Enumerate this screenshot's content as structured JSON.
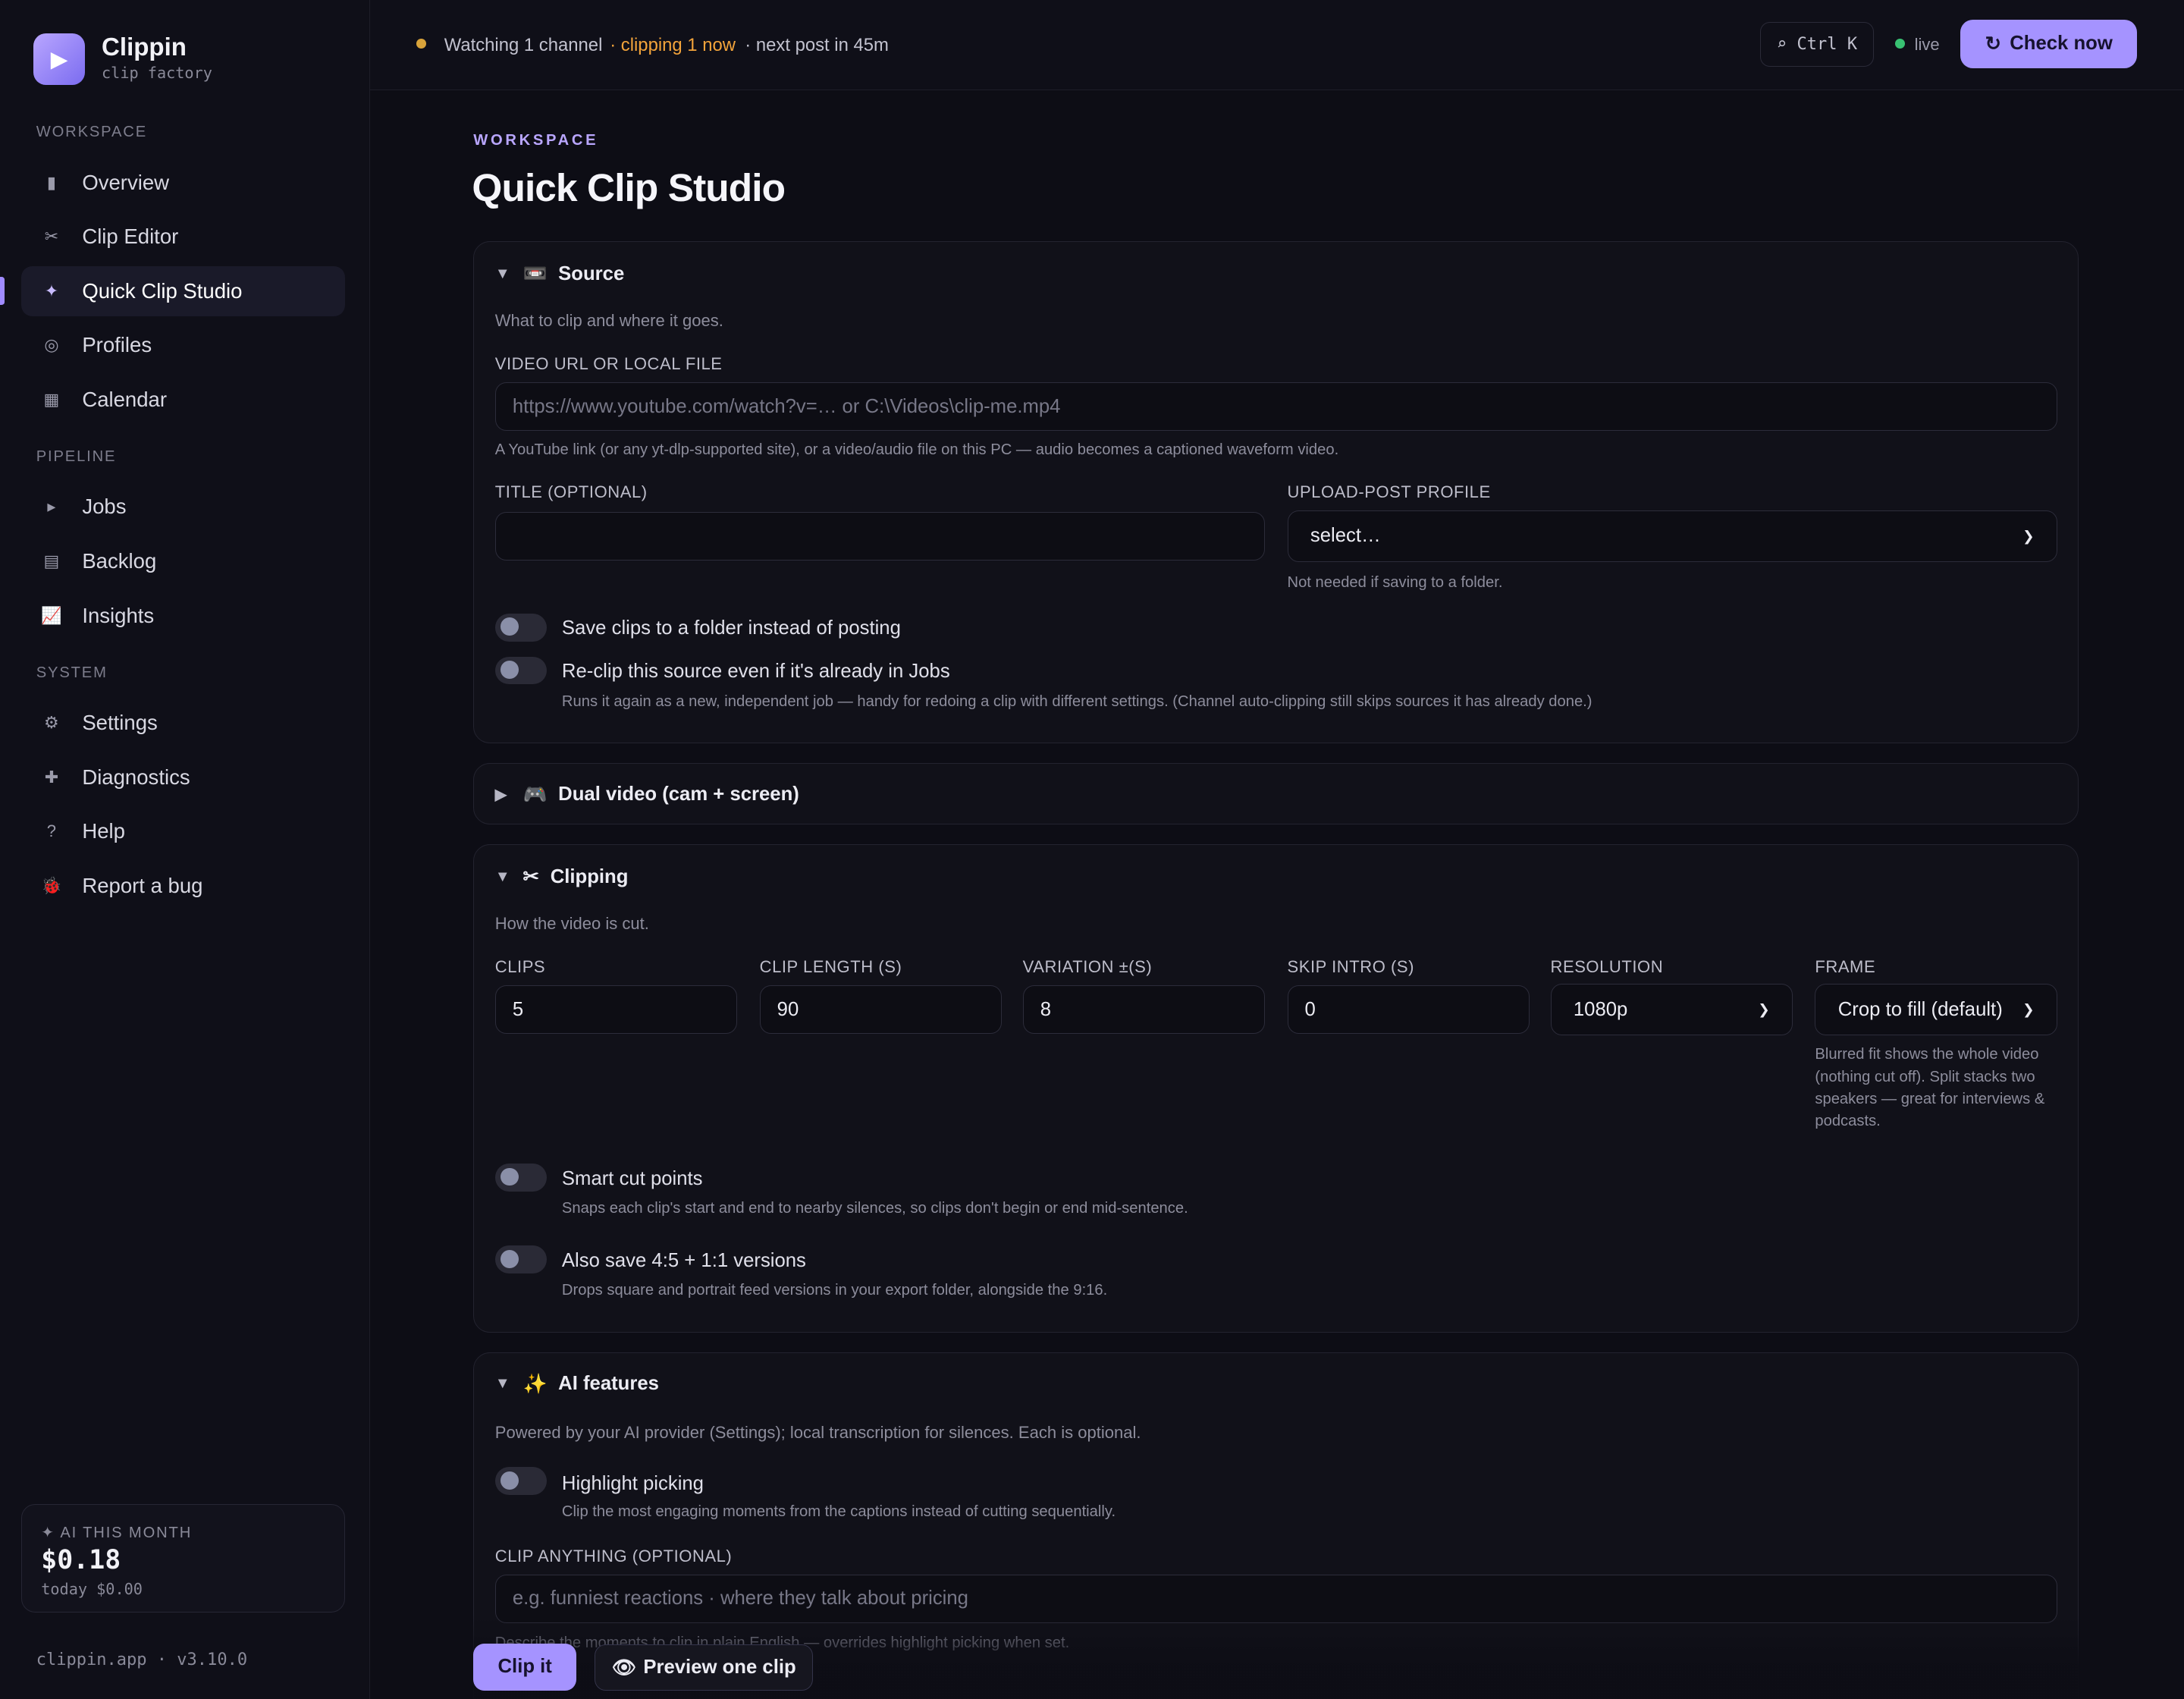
{
  "app": {
    "name": "Clippin",
    "tagline": "clip factory",
    "logo_icon": "play-icon",
    "version_line": "clippin.app · v3.10.0"
  },
  "sidebar": {
    "sections": [
      {
        "label": "WORKSPACE"
      },
      {
        "label": "PIPELINE"
      },
      {
        "label": "SYSTEM"
      }
    ],
    "items": [
      {
        "label": "Overview",
        "icon": "▮"
      },
      {
        "label": "Clip Editor",
        "icon": "✂"
      },
      {
        "label": "Quick Clip Studio",
        "icon": "✦",
        "active": true
      },
      {
        "label": "Profiles",
        "icon": "◎"
      },
      {
        "label": "Calendar",
        "icon": "▦"
      },
      {
        "label": "Jobs",
        "icon": "▸"
      },
      {
        "label": "Backlog",
        "icon": "▤"
      },
      {
        "label": "Insights",
        "icon": "📈"
      },
      {
        "label": "Settings",
        "icon": "⚙"
      },
      {
        "label": "Diagnostics",
        "icon": "✚"
      },
      {
        "label": "Help",
        "icon": "?"
      },
      {
        "label": "Report a bug",
        "icon": "🐞"
      }
    ],
    "ai_card": {
      "title": "✦ AI THIS MONTH",
      "value": "$0.18",
      "today": "today $0.00"
    }
  },
  "topbar": {
    "status_watching": "Watching 1 channel",
    "status_clipping": "· clipping 1 now",
    "status_next": "· next post in 45m",
    "shortcut": "⌕ Ctrl K",
    "live": "live",
    "check_now": "Check now",
    "colors": {
      "clipping": "#f3a43b",
      "live": "#38c172",
      "accent": "#a593ff"
    }
  },
  "main": {
    "eyebrow": "WORKSPACE",
    "title": "Quick Clip Studio",
    "source": {
      "title": "Source",
      "icon": "📼",
      "description": "What to clip and where it goes.",
      "video_label": "VIDEO URL OR LOCAL FILE",
      "video_placeholder": "https://www.youtube.com/watch?v=…  or  C:\\Videos\\clip-me.mp4",
      "video_hint": "A YouTube link (or any yt-dlp-supported site), or a video/audio file on this PC — audio becomes a captioned waveform video.",
      "title_label": "TITLE (OPTIONAL)",
      "title_value": "",
      "profile_label": "UPLOAD-POST PROFILE",
      "profile_value": "select…",
      "profile_hint": "Not needed if saving to a folder.",
      "toggle_folder": "Save clips to a folder instead of posting",
      "toggle_reclip": "Re-clip this source even if it's already in Jobs",
      "toggle_reclip_hint": "Runs it again as a new, independent job — handy for redoing a clip with different settings. (Channel auto-clipping still skips sources it has already done.)"
    },
    "dual": {
      "title": "Dual video (cam + screen)",
      "icon": "🎮"
    },
    "clipping": {
      "title": "Clipping",
      "icon": "✂",
      "description": "How the video is cut.",
      "clips_label": "CLIPS",
      "clips_value": "5",
      "length_label": "CLIP LENGTH (S)",
      "length_value": "90",
      "variation_label": "VARIATION ±(S)",
      "variation_value": "8",
      "skip_label": "SKIP INTRO (S)",
      "skip_value": "0",
      "resolution_label": "RESOLUTION",
      "resolution_value": "1080p",
      "frame_label": "FRAME",
      "frame_value": "Crop to fill (default)",
      "frame_hint": "Blurred fit shows the whole video (nothing cut off). Split stacks two speakers — great for interviews & podcasts.",
      "smart_cut": "Smart cut points",
      "smart_cut_hint": "Snaps each clip's start and end to nearby silences, so clips don't begin or end mid-sentence.",
      "also_save": "Also save 4:5 + 1:1 versions",
      "also_save_hint": "Drops square and portrait feed versions in your export folder, alongside the 9:16."
    },
    "ai": {
      "title": "AI features",
      "icon": "✨",
      "description": "Powered by your AI provider (Settings); local transcription for silences. Each is optional.",
      "highlight": "Highlight picking",
      "highlight_hint": "Clip the most engaging moments from the captions instead of cutting sequentially.",
      "anything_label": "CLIP ANYTHING (OPTIONAL)",
      "anything_placeholder": "e.g. funniest reactions · where they talk about pricing",
      "anything_hint": "Describe the moments to clip in plain English — overrides highlight picking when set."
    }
  },
  "actions": {
    "clip_it": "Clip it",
    "preview": "Preview one clip"
  }
}
